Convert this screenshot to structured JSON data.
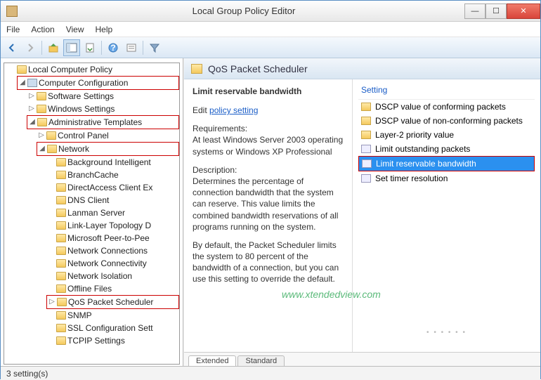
{
  "window": {
    "title": "Local Group Policy Editor"
  },
  "menu": {
    "file": "File",
    "action": "Action",
    "view": "View",
    "help": "Help"
  },
  "tree": {
    "root": "Local Computer Policy",
    "comp_config": "Computer Configuration",
    "software": "Software Settings",
    "windows": "Windows Settings",
    "admin": "Administrative Templates",
    "control_panel": "Control Panel",
    "network": "Network",
    "net_children": [
      "Background Intelligent",
      "BranchCache",
      "DirectAccess Client Ex",
      "DNS Client",
      "Lanman Server",
      "Link-Layer Topology D",
      "Microsoft Peer-to-Pee",
      "Network Connections",
      "Network Connectivity",
      "Network Isolation",
      "Offline Files",
      "QoS Packet Scheduler",
      "SNMP",
      "SSL Configuration Sett",
      "TCPIP Settings"
    ]
  },
  "content": {
    "header": "QoS Packet Scheduler",
    "desc_title": "Limit reservable bandwidth",
    "edit_label": "Edit",
    "policy_link": "policy setting",
    "req_label": "Requirements:",
    "req_text": "At least Windows Server 2003 operating systems or Windows XP Professional",
    "desc_label": "Description:",
    "desc_text": "Determines the percentage of connection bandwidth that the system can reserve. This value limits the combined bandwidth reservations of all programs running on the system.",
    "desc_text2": "By default, the Packet Scheduler limits the system to 80 percent of the bandwidth of a connection, but you can use this setting to override the default.",
    "col_setting": "Setting",
    "settings": [
      {
        "type": "fld",
        "label": "DSCP value of conforming packets"
      },
      {
        "type": "fld",
        "label": "DSCP value of non-conforming packets"
      },
      {
        "type": "fld",
        "label": "Layer-2 priority value"
      },
      {
        "type": "cfg",
        "label": "Limit outstanding packets"
      },
      {
        "type": "cfg",
        "label": "Limit reservable bandwidth",
        "selected": true
      },
      {
        "type": "cfg",
        "label": "Set timer resolution"
      }
    ],
    "tabs": {
      "extended": "Extended",
      "standard": "Standard"
    }
  },
  "status": "3 setting(s)",
  "watermark": "www.xtendedview.com"
}
